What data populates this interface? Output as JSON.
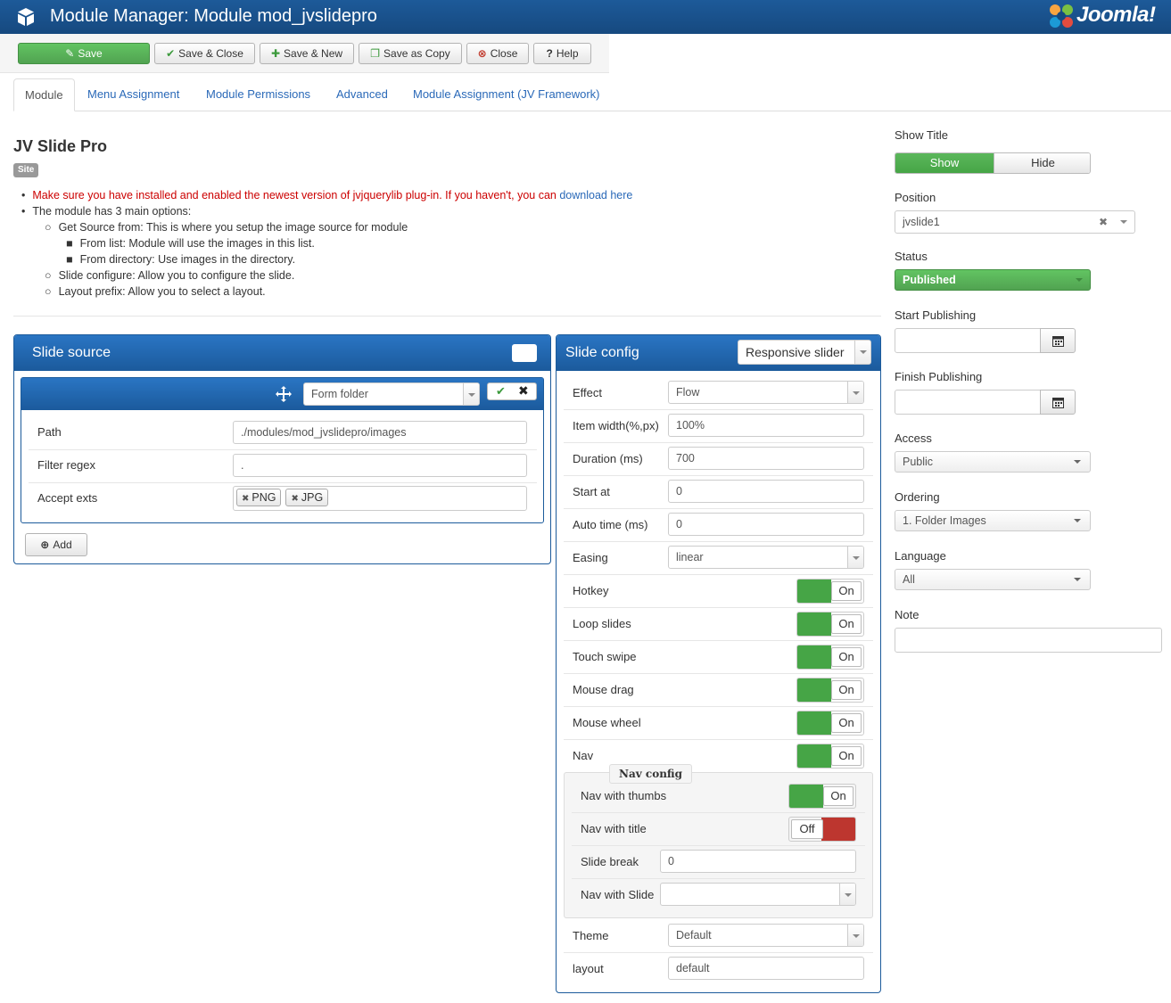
{
  "header": {
    "title": "Module Manager: Module mod_jvslidepro",
    "brand": "Joomla!"
  },
  "toolbar": {
    "save": "Save",
    "save_close": "Save & Close",
    "save_new": "Save & New",
    "save_copy": "Save as Copy",
    "close": "Close",
    "help": "Help"
  },
  "tabs": [
    "Module",
    "Menu Assignment",
    "Module Permissions",
    "Advanced",
    "Module Assignment (JV Framework)"
  ],
  "module": {
    "title": "JV Slide Pro",
    "badge": "Site",
    "notice_text": "Make sure you have installed and enabled the newest version of jvjquerylib plug-in. If you haven't, you can",
    "notice_link": "download here",
    "lines": [
      "The module has 3 main options:",
      "Get Source from: This is where you setup the image source for module",
      "From list: Module will use the images in this list.",
      "From directory: Use images in the directory.",
      "Slide configure: Allow you to configure the slide.",
      "Layout prefix: Allow you to select a layout."
    ]
  },
  "slide_source": {
    "title": "Slide source",
    "source_type": "Form folder",
    "path_label": "Path",
    "path_value": "./modules/mod_jvslidepro/images",
    "filter_label": "Filter regex",
    "filter_value": ".",
    "exts_label": "Accept exts",
    "exts": [
      "PNG",
      "JPG"
    ],
    "add_label": "Add"
  },
  "slide_config": {
    "title": "Slide config",
    "mode": "Responsive slider",
    "fields": {
      "effect": {
        "label": "Effect",
        "value": "Flow"
      },
      "item_width": {
        "label": "Item width(%,px)",
        "value": "100%"
      },
      "duration": {
        "label": "Duration (ms)",
        "value": "700"
      },
      "start_at": {
        "label": "Start at",
        "value": "0"
      },
      "auto_time": {
        "label": "Auto time (ms)",
        "value": "0"
      },
      "easing": {
        "label": "Easing",
        "value": "linear"
      }
    },
    "toggles": {
      "hotkey": {
        "label": "Hotkey",
        "value": "On"
      },
      "loop": {
        "label": "Loop slides",
        "value": "On"
      },
      "touch": {
        "label": "Touch swipe",
        "value": "On"
      },
      "mouse_drag": {
        "label": "Mouse drag",
        "value": "On"
      },
      "mouse_wheel": {
        "label": "Mouse wheel",
        "value": "On"
      },
      "nav": {
        "label": "Nav",
        "value": "On"
      }
    },
    "nav_config": {
      "legend": "Nav config",
      "thumbs": {
        "label": "Nav with thumbs",
        "value": "On"
      },
      "title": {
        "label": "Nav with title",
        "value": "Off"
      },
      "slide_break": {
        "label": "Slide break",
        "value": "0"
      },
      "nav_slide": {
        "label": "Nav with Slide",
        "value": ""
      }
    },
    "theme": {
      "label": "Theme",
      "value": "Default"
    },
    "layout": {
      "label": "layout",
      "value": "default"
    }
  },
  "sidebar": {
    "show_title": {
      "label": "Show Title",
      "show": "Show",
      "hide": "Hide"
    },
    "position": {
      "label": "Position",
      "value": "jvslide1"
    },
    "status": {
      "label": "Status",
      "value": "Published"
    },
    "start_publishing": {
      "label": "Start Publishing",
      "value": ""
    },
    "finish_publishing": {
      "label": "Finish Publishing",
      "value": ""
    },
    "access": {
      "label": "Access",
      "value": "Public"
    },
    "ordering": {
      "label": "Ordering",
      "value": "1. Folder Images"
    },
    "language": {
      "label": "Language",
      "value": "All"
    },
    "note": {
      "label": "Note",
      "value": ""
    }
  },
  "colors": {
    "header_blue": "#1b5a9c",
    "green": "#46a546",
    "red": "#bd362f",
    "link": "#2a69b8"
  }
}
